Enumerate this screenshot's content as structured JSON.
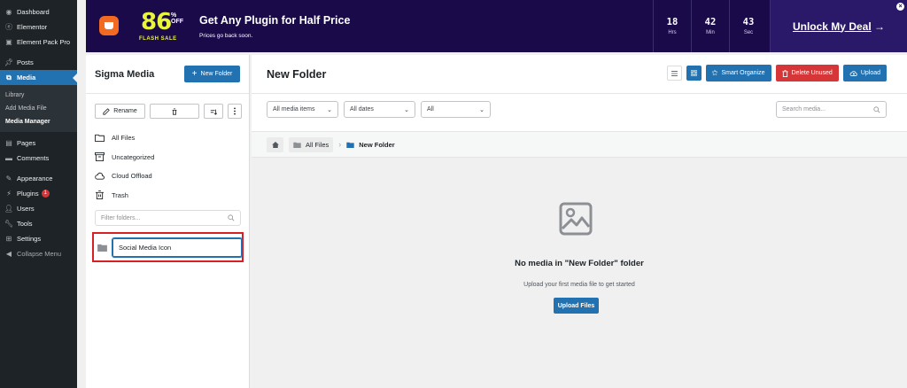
{
  "wp_menu": {
    "items": [
      {
        "label": "Dashboard",
        "icon": "dashboard-icon"
      },
      {
        "label": "Elementor",
        "icon": "elementor-icon"
      },
      {
        "label": "Element Pack Pro",
        "icon": "element-pack-icon"
      },
      {
        "label": "Posts",
        "icon": "pin-icon"
      },
      {
        "label": "Media",
        "icon": "media-icon"
      },
      {
        "label": "Pages",
        "icon": "pages-icon"
      },
      {
        "label": "Comments",
        "icon": "comments-icon"
      },
      {
        "label": "Appearance",
        "icon": "appearance-icon"
      },
      {
        "label": "Plugins",
        "icon": "plugins-icon",
        "badge": "1"
      },
      {
        "label": "Users",
        "icon": "users-icon"
      },
      {
        "label": "Tools",
        "icon": "tools-icon"
      },
      {
        "label": "Settings",
        "icon": "settings-icon"
      },
      {
        "label": "Collapse Menu",
        "icon": "collapse-icon"
      }
    ],
    "media_sub": [
      "Library",
      "Add Media File",
      "Media Manager"
    ]
  },
  "banner": {
    "discount": "86",
    "pct": "%",
    "off": "OFF",
    "flash_sale": "FLASH SALE",
    "title": "Get Any Plugin for Half Price",
    "subtitle": "Prices go back soon.",
    "timer": [
      {
        "value": "18",
        "unit": "Hrs"
      },
      {
        "value": "42",
        "unit": "Min"
      },
      {
        "value": "43",
        "unit": "Sec"
      }
    ],
    "cta": "Unlock My Deal",
    "cta_arrow": "→",
    "close": "×"
  },
  "left": {
    "title": "Sigma Media",
    "new_folder": "New Folder",
    "rename": "Rename",
    "folders": [
      {
        "label": "All Files",
        "icon": "folder-icon"
      },
      {
        "label": "Uncategorized",
        "icon": "archive-icon"
      },
      {
        "label": "Cloud Offload",
        "icon": "cloud-icon"
      },
      {
        "label": "Trash",
        "icon": "trash-icon"
      }
    ],
    "filter_placeholder": "Filter folders...",
    "rename_value": "Social Media Icon"
  },
  "main": {
    "title": "New Folder",
    "smart_organize": "Smart Organize",
    "delete_unused": "Delete Unused",
    "upload": "Upload",
    "filters": [
      {
        "label": "All media items"
      },
      {
        "label": "All dates"
      },
      {
        "label": "All"
      }
    ],
    "search_placeholder": "Search media...",
    "breadcrumb": {
      "root": "All Files",
      "current": "New Folder",
      "separator": "›"
    },
    "empty": {
      "title": "No media in \"New Folder\" folder",
      "subtitle": "Upload your first media file to get started",
      "button": "Upload Files"
    }
  },
  "colors": {
    "accent": "#2271b1",
    "danger": "#d63638",
    "banner_bg": "#1a0a4a",
    "highlight": "#d62024"
  }
}
